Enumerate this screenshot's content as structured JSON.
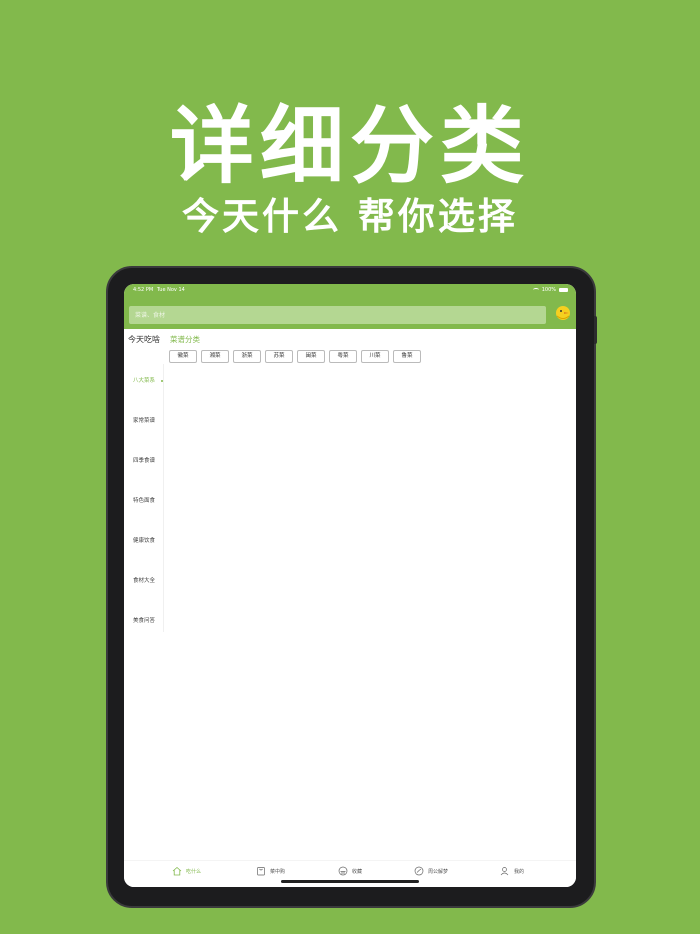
{
  "promo": {
    "headline": "详细分类",
    "subline": "今天什么 帮你选择"
  },
  "statusbar": {
    "time": "4:52 PM",
    "date": "Tue Nov 14",
    "battery": "100%"
  },
  "search": {
    "placeholder": "菜谱、食材"
  },
  "header": {
    "left_title": "今天吃啥",
    "right_title": "菜谱分类"
  },
  "tags": [
    "徽菜",
    "湘菜",
    "浙菜",
    "苏菜",
    "闽菜",
    "粤菜",
    "川菜",
    "鲁菜"
  ],
  "sidebar": {
    "items": [
      {
        "label": "八大菜系",
        "active": true
      },
      {
        "label": "家常菜谱",
        "active": false
      },
      {
        "label": "四季食谱",
        "active": false
      },
      {
        "label": "特色面食",
        "active": false
      },
      {
        "label": "健康饮食",
        "active": false
      },
      {
        "label": "食材大全",
        "active": false
      },
      {
        "label": "美食问答",
        "active": false
      }
    ]
  },
  "tabbar": {
    "items": [
      {
        "label": "吃什么",
        "icon": "home-icon",
        "active": true
      },
      {
        "label": "菜中购",
        "icon": "bag-icon",
        "active": false
      },
      {
        "label": "收藏",
        "icon": "pot-icon",
        "active": false
      },
      {
        "label": "周公解梦",
        "icon": "moon-icon",
        "active": false
      },
      {
        "label": "我的",
        "icon": "user-icon",
        "active": false
      }
    ]
  },
  "colors": {
    "brand": "#82b94c",
    "search_bg": "#b4d792",
    "device": "#1c1c1e"
  }
}
